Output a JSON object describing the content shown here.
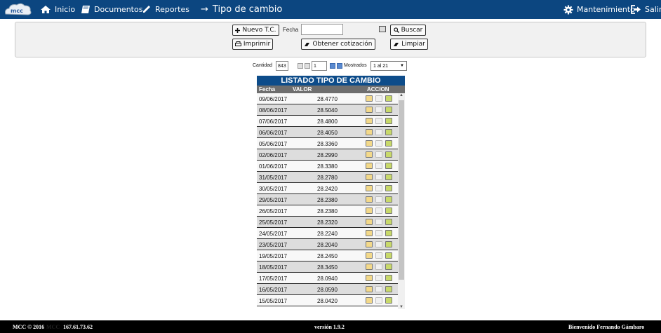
{
  "nav": {
    "inicio": "Inicio",
    "documentos": "Documentos",
    "reportes": "Reportes",
    "title": "Tipo de cambio",
    "mantenimiento": "Mantenimiento",
    "salir": "Salir",
    "logo": "mcc"
  },
  "toolbar": {
    "nuevo": "Nuevo T.C.",
    "fecha_label": "Fecha",
    "fecha_value": "",
    "buscar": "Buscar",
    "imprimir": "Imprimir",
    "obtener": "Obtener cotización",
    "limpiar": "Limpiar"
  },
  "pager": {
    "cantidad_label": "Cantidad",
    "cantidad": "843",
    "page": "1",
    "mostrados_label": "Mostrados",
    "mostrados": "1 al 21"
  },
  "grid": {
    "title": "LISTADO TIPO DE CAMBIO",
    "headers": [
      "Fecha",
      "VALOR",
      "ACCION"
    ],
    "rows": [
      [
        "09/06/2017",
        "28.4770"
      ],
      [
        "08/06/2017",
        "28.5040"
      ],
      [
        "07/06/2017",
        "28.4800"
      ],
      [
        "06/06/2017",
        "28.4050"
      ],
      [
        "05/06/2017",
        "28.3360"
      ],
      [
        "02/06/2017",
        "28.2990"
      ],
      [
        "01/06/2017",
        "28.3380"
      ],
      [
        "31/05/2017",
        "28.2780"
      ],
      [
        "30/05/2017",
        "28.2420"
      ],
      [
        "29/05/2017",
        "28.2380"
      ],
      [
        "26/05/2017",
        "28.2380"
      ],
      [
        "25/05/2017",
        "28.2320"
      ],
      [
        "24/05/2017",
        "28.2240"
      ],
      [
        "23/05/2017",
        "28.2040"
      ],
      [
        "19/05/2017",
        "28.2450"
      ],
      [
        "18/05/2017",
        "28.3450"
      ],
      [
        "17/05/2017",
        "28.0940"
      ],
      [
        "16/05/2017",
        "28.0590"
      ],
      [
        "15/05/2017",
        "28.0420"
      ]
    ]
  },
  "footer": {
    "copyright": "MCC © 2016",
    "brand": "MCC",
    "ip": "167.61.73.62",
    "version": "versión 1.9.2",
    "welcome": "Bienvenido Fernando Gámbaro"
  }
}
